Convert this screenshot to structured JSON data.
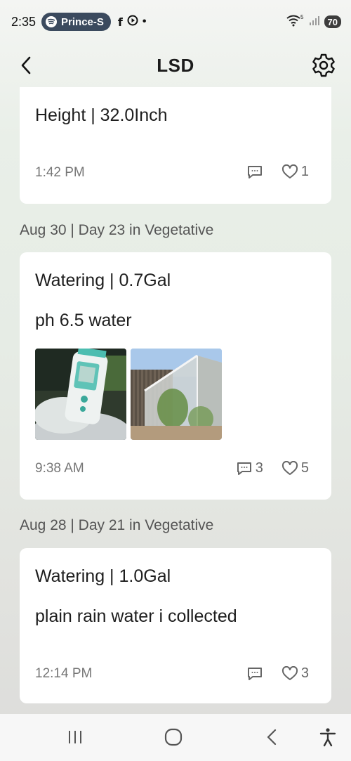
{
  "status_bar": {
    "time": "2:35",
    "spotify_label": "Prince-S",
    "battery": "70",
    "wifi_superscript": "5"
  },
  "header": {
    "title": "LSD"
  },
  "entries": [
    {
      "title": "Height | 32.0Inch",
      "time": "1:42 PM",
      "likes": "1"
    },
    {
      "date_header": "Aug 30 | Day 23 in Vegetative",
      "title": "Watering | 0.7Gal",
      "note": "ph 6.5 water",
      "photos": [
        "ph-meter-photo",
        "greenhouse-photo"
      ],
      "time": "9:38 AM",
      "comments": "3",
      "likes": "5"
    },
    {
      "date_header": "Aug 28 | Day 21 in Vegetative",
      "title": "Watering | 1.0Gal",
      "note": "plain rain water i collected",
      "time": "12:14 PM",
      "likes": "3"
    }
  ],
  "icons": {
    "back": "chevron-left-icon",
    "settings": "gear-icon",
    "comment": "comment-icon",
    "like": "heart-icon"
  },
  "colors": {
    "card": "#ffffff",
    "muted_text": "#777777",
    "spotify_pill": "#3b4a5e"
  }
}
